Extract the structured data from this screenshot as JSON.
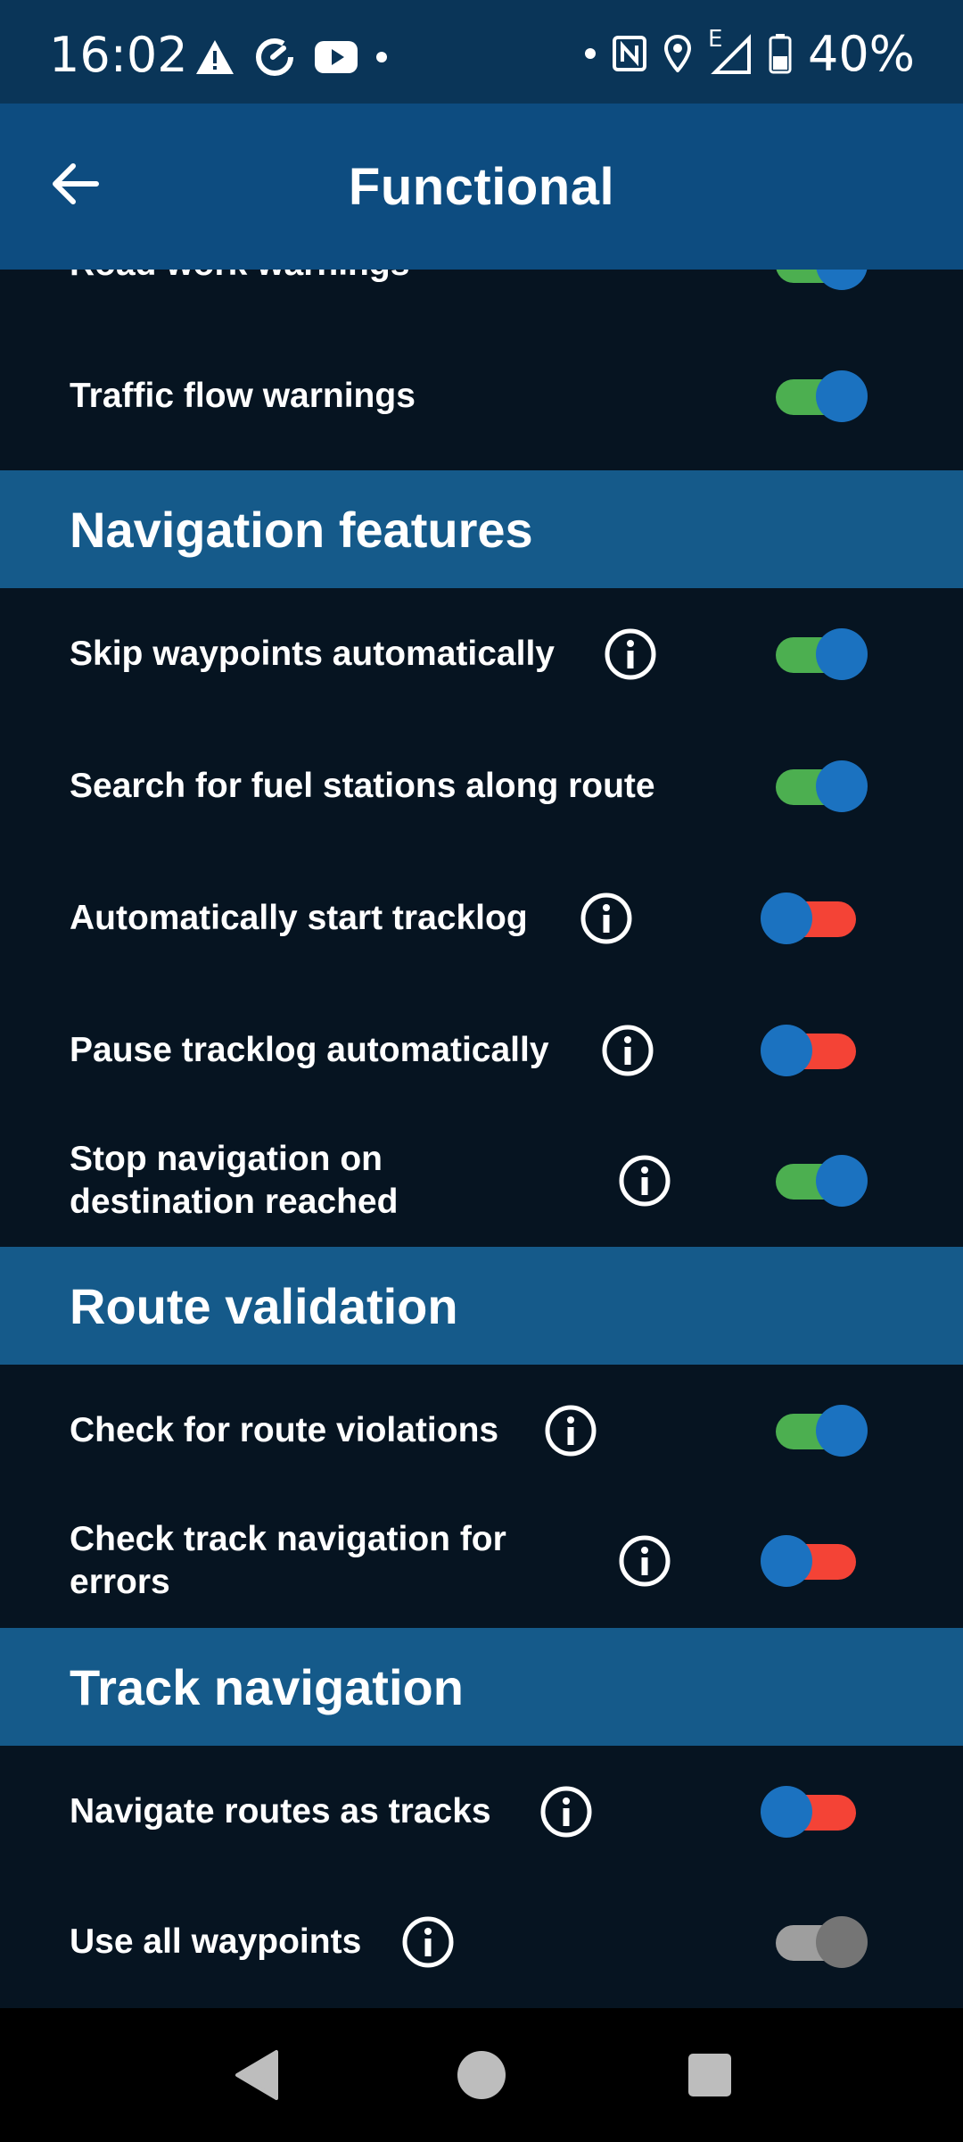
{
  "status_bar": {
    "time": "16:02",
    "left_icons": [
      "warning-icon",
      "sync-icon",
      "youtube-icon",
      "dot-icon"
    ],
    "right_icons": [
      "dot-icon",
      "nfc-icon",
      "location-icon",
      "signal-icon",
      "battery-icon"
    ],
    "network_type": "E",
    "battery_percent": "40%"
  },
  "app_bar": {
    "title": "Functional",
    "back_icon": "arrow-back-icon"
  },
  "top_rows": [
    {
      "label": "Road work warnings",
      "state": "on"
    },
    {
      "label": "Traffic flow warnings",
      "state": "on"
    }
  ],
  "sections": [
    {
      "title": "Navigation features",
      "rows": [
        {
          "label": "Skip waypoints automatically",
          "info": true,
          "state": "on"
        },
        {
          "label": "Search for fuel stations along route",
          "info": false,
          "state": "on"
        },
        {
          "label": "Automatically start tracklog",
          "info": true,
          "state": "off"
        },
        {
          "label": "Pause tracklog automatically",
          "info": true,
          "state": "off"
        },
        {
          "label": "Stop navigation on destination reached",
          "info": true,
          "state": "on"
        }
      ]
    },
    {
      "title": "Route validation",
      "rows": [
        {
          "label": "Check for route violations",
          "info": true,
          "state": "on"
        },
        {
          "label": "Check track navigation for errors",
          "info": true,
          "state": "off"
        }
      ]
    },
    {
      "title": "Track navigation",
      "rows": [
        {
          "label": "Navigate routes as tracks",
          "info": true,
          "state": "off"
        },
        {
          "label": "Use all waypoints",
          "info": true,
          "state": "disabled"
        }
      ]
    }
  ],
  "colors": {
    "status_bar": "#0a3558",
    "app_bar": "#0d4c80",
    "section_header": "#155a8a",
    "background": "#061421",
    "toggle_on_track": "#4caf50",
    "toggle_off_track": "#f44336",
    "toggle_thumb": "#1b72c0"
  },
  "system_nav": {
    "buttons": [
      "back-triangle-icon",
      "home-circle-icon",
      "recents-square-icon"
    ]
  }
}
